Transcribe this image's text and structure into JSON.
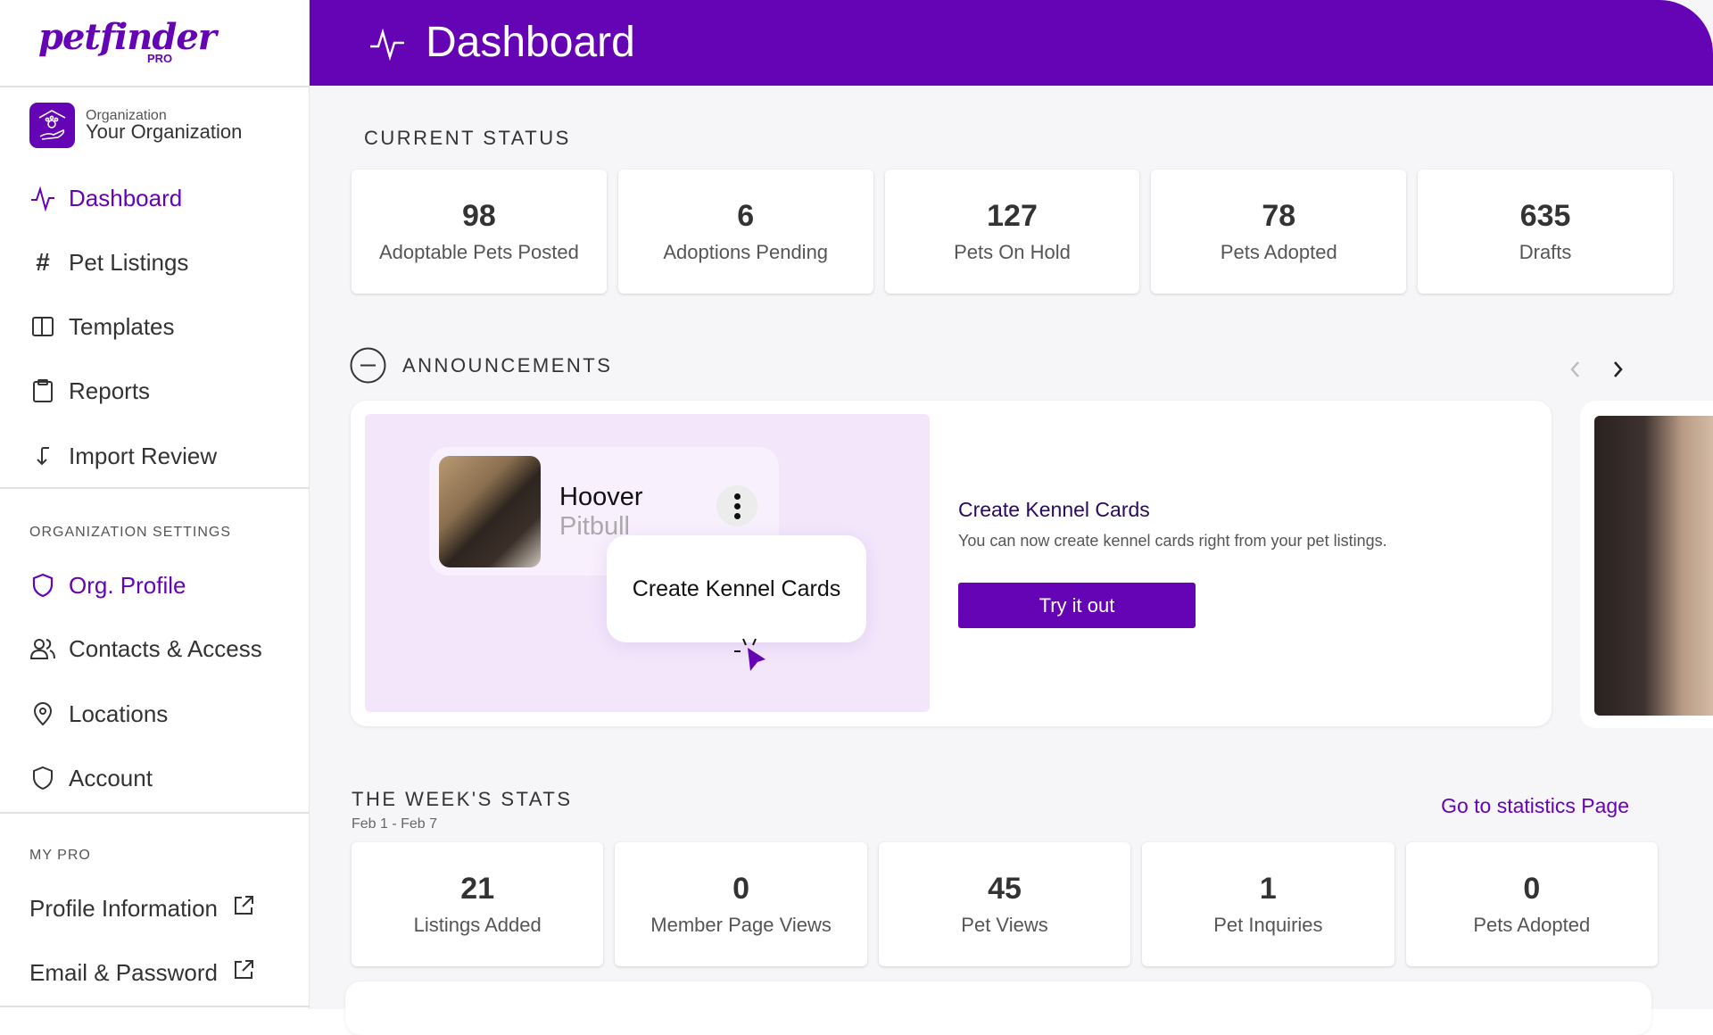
{
  "brand": {
    "logo": "petfinder",
    "sub": "PRO",
    "color": "#6504b5"
  },
  "org": {
    "label": "Organization",
    "name": "Your Organization"
  },
  "nav": [
    {
      "label": "Dashboard",
      "icon": "pulse-icon"
    },
    {
      "label": "Pet Listings",
      "icon": "hash-icon"
    },
    {
      "label": "Templates",
      "icon": "columns-icon"
    },
    {
      "label": "Reports",
      "icon": "clipboard-icon"
    },
    {
      "label": "Import Review",
      "icon": "import-arrow-icon"
    }
  ],
  "org_settings": {
    "title": "ORGANIZATION SETTINGS",
    "items": [
      {
        "label": "Org. Profile"
      },
      {
        "label": "Contacts & Access"
      },
      {
        "label": "Locations"
      },
      {
        "label": "Account"
      }
    ]
  },
  "my_pro": {
    "title": "MY PRO",
    "items": [
      {
        "label": "Profile Information"
      },
      {
        "label": "Email & Password"
      }
    ]
  },
  "header": {
    "title": "Dashboard"
  },
  "current_status": {
    "title": "CURRENT STATUS",
    "cards": [
      {
        "value": "98",
        "label": "Adoptable Pets Posted"
      },
      {
        "value": "6",
        "label": "Adoptions Pending"
      },
      {
        "value": "127",
        "label": "Pets On Hold"
      },
      {
        "value": "78",
        "label": "Pets Adopted"
      },
      {
        "value": "635",
        "label": "Drafts"
      }
    ]
  },
  "announcements": {
    "title": "ANNOUNCEMENTS",
    "item": {
      "pet_name": "Hoover",
      "pet_breed": "Pitbull",
      "popup": "Create Kennel Cards",
      "title": "Create Kennel Cards",
      "description": "You can now create kennel cards right from your pet listings.",
      "button": "Try it out"
    }
  },
  "week_stats": {
    "title": "THE WEEK'S STATS",
    "range": "Feb 1 - Feb 7",
    "link": "Go to statistics Page",
    "cards": [
      {
        "value": "21",
        "label": "Listings Added"
      },
      {
        "value": "0",
        "label": "Member Page Views"
      },
      {
        "value": "45",
        "label": "Pet Views"
      },
      {
        "value": "1",
        "label": "Pet Inquiries"
      },
      {
        "value": "0",
        "label": "Pets Adopted"
      }
    ]
  }
}
